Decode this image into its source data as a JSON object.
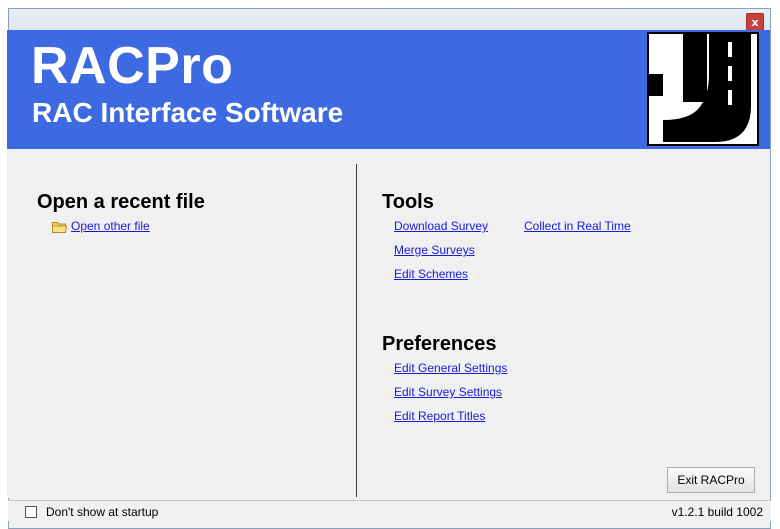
{
  "window": {
    "close_label": "x"
  },
  "banner": {
    "title": "RACPro",
    "subtitle": "RAC Interface Software",
    "logo_icon": "road-logo-icon"
  },
  "recent": {
    "heading": "Open a recent file",
    "open_other": "Open other file",
    "folder_icon": "folder-icon"
  },
  "tools": {
    "heading": "Tools",
    "links": [
      "Download Survey",
      "Merge Surveys",
      "Edit Schemes",
      "Collect in Real Time"
    ]
  },
  "preferences": {
    "heading": "Preferences",
    "links": [
      "Edit General Settings",
      "Edit Survey Settings",
      "Edit Report Titles"
    ]
  },
  "exit_button": "Exit RACPro",
  "statusbar": {
    "checkbox_label": "Don't show at startup",
    "checkbox_checked": false,
    "version": "v1.2.1 build 1002"
  },
  "colors": {
    "banner": "#3e6ae1",
    "link": "#1a1adb",
    "close": "#c9403a"
  }
}
